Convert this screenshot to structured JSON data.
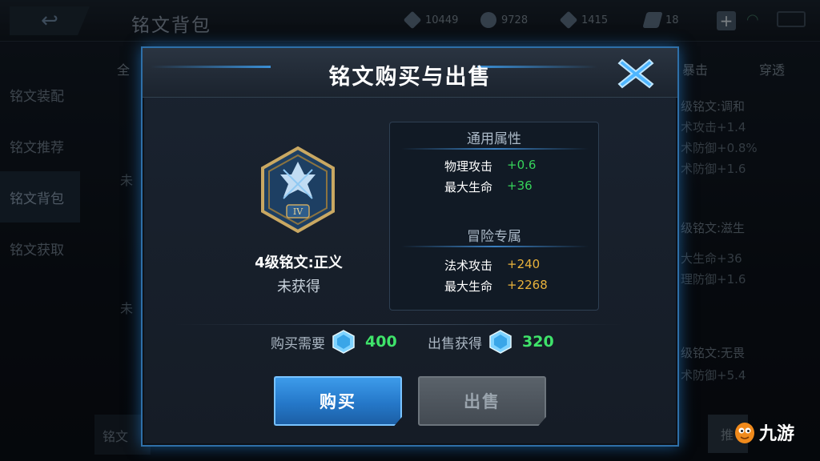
{
  "colors": {
    "accent": "#2e8be0",
    "value_green": "#36d35a",
    "value_gold": "#e9b23b"
  },
  "background": {
    "page_title": "铭文背包",
    "currencies": [
      {
        "icon": "diamond-icon",
        "value": "10449"
      },
      {
        "icon": "coin-icon",
        "value": "9728"
      },
      {
        "icon": "dice-icon",
        "value": "1415"
      },
      {
        "icon": "fragment-icon",
        "value": "18"
      }
    ],
    "sidebar": [
      {
        "label": "铭文装配"
      },
      {
        "label": "铭文推荐"
      },
      {
        "label": "铭文背包"
      },
      {
        "label": "铭文获取"
      }
    ],
    "tabs": [
      "全",
      "暴击",
      "穿透"
    ],
    "right_panel": {
      "line1": "级铭文:调和",
      "line2": "术攻击+1.4",
      "line3": "术防御+0.8%",
      "line4": "术防御+1.6",
      "line5": "级铭文:滋生",
      "line6": "大生命+36",
      "line7": "理防御+1.6",
      "line8": "级铭文:无畏",
      "line9": "术防御+5.4"
    },
    "bottom_tab": "铭文",
    "bottom_btn": "推",
    "left_partial_1": "未",
    "left_partial_2": "未"
  },
  "dialog": {
    "title": "铭文购买与出售",
    "rune": {
      "name": "4级铭文:正义",
      "status": "未获得",
      "level_numeral": "IV"
    },
    "general": {
      "title": "通用属性",
      "rows": [
        {
          "label": "物理攻击",
          "value": "+0.6"
        },
        {
          "label": "最大生命",
          "value": "+36"
        }
      ]
    },
    "adventure": {
      "title": "冒险专属",
      "rows": [
        {
          "label": "法术攻击",
          "value": "+240"
        },
        {
          "label": "最大生命",
          "value": "+2268"
        }
      ]
    },
    "buy_price": {
      "label": "购买需要",
      "value": "400"
    },
    "sell_price": {
      "label": "出售获得",
      "value": "320"
    },
    "buy_button": "购买",
    "sell_button": "出售"
  },
  "watermark": "九游"
}
